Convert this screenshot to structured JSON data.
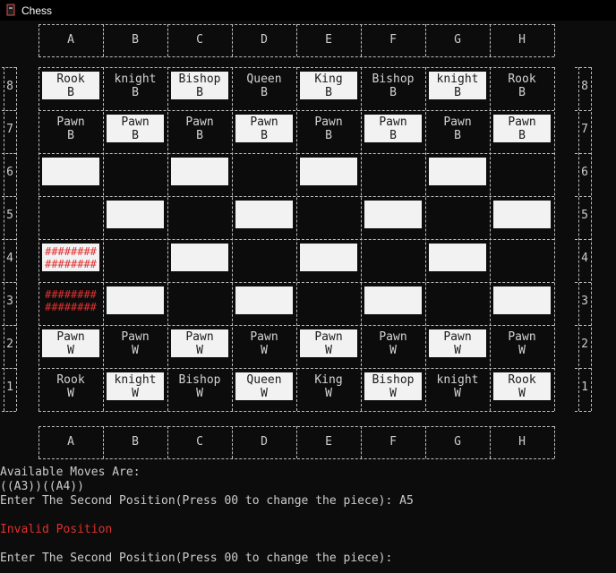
{
  "window": {
    "title": "Chess",
    "icon": "terminal-app-icon"
  },
  "files": [
    "A",
    "B",
    "C",
    "D",
    "E",
    "F",
    "G",
    "H"
  ],
  "ranks": [
    "8",
    "7",
    "6",
    "5",
    "4",
    "3",
    "2",
    "1"
  ],
  "board": [
    [
      {
        "p": "Rook",
        "c": "B"
      },
      {
        "p": "knight",
        "c": "B"
      },
      {
        "p": "Bishop",
        "c": "B"
      },
      {
        "p": "Queen",
        "c": "B"
      },
      {
        "p": "King",
        "c": "B"
      },
      {
        "p": "Bishop",
        "c": "B"
      },
      {
        "p": "knight",
        "c": "B"
      },
      {
        "p": "Rook",
        "c": "B"
      }
    ],
    [
      {
        "p": "Pawn",
        "c": "B"
      },
      {
        "p": "Pawn",
        "c": "B"
      },
      {
        "p": "Pawn",
        "c": "B"
      },
      {
        "p": "Pawn",
        "c": "B"
      },
      {
        "p": "Pawn",
        "c": "B"
      },
      {
        "p": "Pawn",
        "c": "B"
      },
      {
        "p": "Pawn",
        "c": "B"
      },
      {
        "p": "Pawn",
        "c": "B"
      }
    ],
    [
      {},
      {},
      {},
      {},
      {},
      {},
      {},
      {}
    ],
    [
      {},
      {},
      {},
      {},
      {},
      {},
      {},
      {}
    ],
    [
      {
        "m": "########"
      },
      {},
      {},
      {},
      {},
      {},
      {},
      {}
    ],
    [
      {
        "m": "########"
      },
      {},
      {},
      {},
      {},
      {},
      {},
      {}
    ],
    [
      {
        "p": "Pawn",
        "c": "W"
      },
      {
        "p": "Pawn",
        "c": "W"
      },
      {
        "p": "Pawn",
        "c": "W"
      },
      {
        "p": "Pawn",
        "c": "W"
      },
      {
        "p": "Pawn",
        "c": "W"
      },
      {
        "p": "Pawn",
        "c": "W"
      },
      {
        "p": "Pawn",
        "c": "W"
      },
      {
        "p": "Pawn",
        "c": "W"
      }
    ],
    [
      {
        "p": "Rook",
        "c": "W"
      },
      {
        "p": "knight",
        "c": "W"
      },
      {
        "p": "Bishop",
        "c": "W"
      },
      {
        "p": "Queen",
        "c": "W"
      },
      {
        "p": "King",
        "c": "W"
      },
      {
        "p": "Bishop",
        "c": "W"
      },
      {
        "p": "knight",
        "c": "W"
      },
      {
        "p": "Rook",
        "c": "W"
      }
    ]
  ],
  "colors": {
    "light_square": "#f2f2f2",
    "highlight": "#e0302e",
    "background": "#0c0c0c"
  },
  "console": {
    "moves_header": "Available Moves Are:",
    "moves": "((A3))((A4))",
    "prompt1": "Enter The Second Position(Press 00 to change the piece): A5",
    "error": "Invalid Position",
    "prompt2": "Enter The Second Position(Press 00 to change the piece):"
  }
}
